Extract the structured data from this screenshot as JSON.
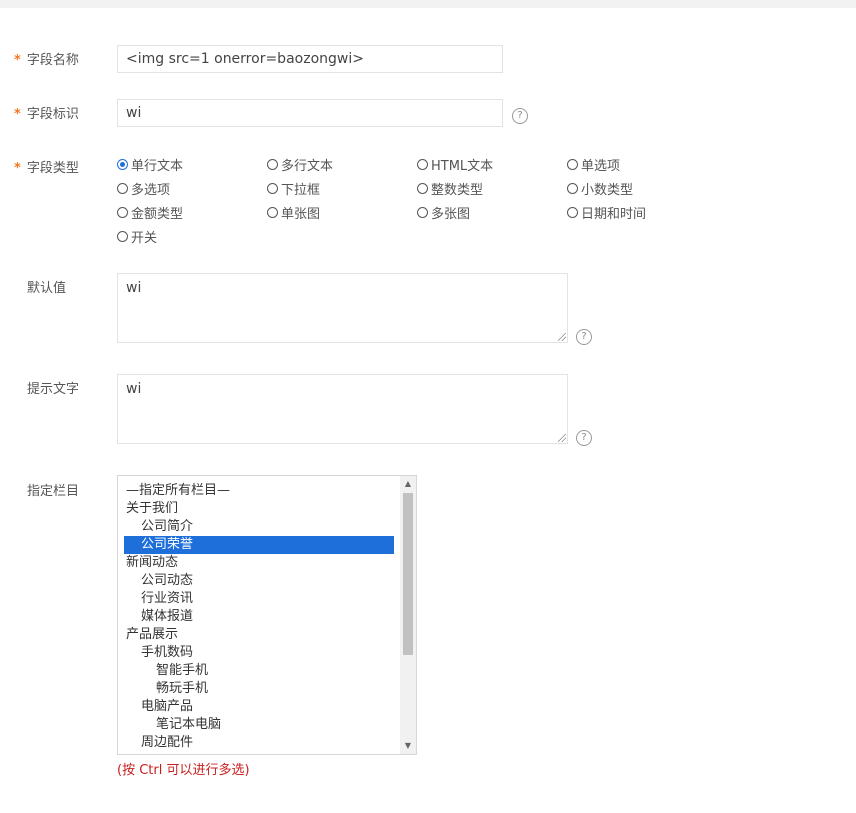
{
  "fields": {
    "field_name": {
      "label": "字段名称",
      "required_mark": "*",
      "value": "<img src=1 onerror=baozongwi>"
    },
    "field_id": {
      "label": "字段标识",
      "required_mark": "*",
      "value": "wi",
      "help": "?"
    },
    "field_type": {
      "label": "字段类型",
      "required_mark": "*",
      "options": [
        "单行文本",
        "多行文本",
        "HTML文本",
        "单选项",
        "多选项",
        "下拉框",
        "整数类型",
        "小数类型",
        "金额类型",
        "单张图",
        "多张图",
        "日期和时间",
        "开关"
      ],
      "selected": "单行文本"
    },
    "default_value": {
      "label": "默认值",
      "value": "wi",
      "help": "?"
    },
    "hint_text": {
      "label": "提示文字",
      "value": "wi",
      "help": "?"
    },
    "category": {
      "label": "指定栏目",
      "items": [
        "—指定所有栏目—",
        "关于我们",
        "公司简介",
        "公司荣誉",
        "新闻动态",
        "公司动态",
        "行业资讯",
        "媒体报道",
        "产品展示",
        "手机数码",
        "智能手机",
        "畅玩手机",
        "电脑产品",
        "笔记本电脑",
        "周边配件"
      ],
      "selected": "公司荣誉",
      "hint": "(按 Ctrl 可以进行多选)"
    }
  },
  "colors": {
    "accent": "#1e6fd9",
    "required": "#f27721",
    "hint": "#c81e1e"
  }
}
